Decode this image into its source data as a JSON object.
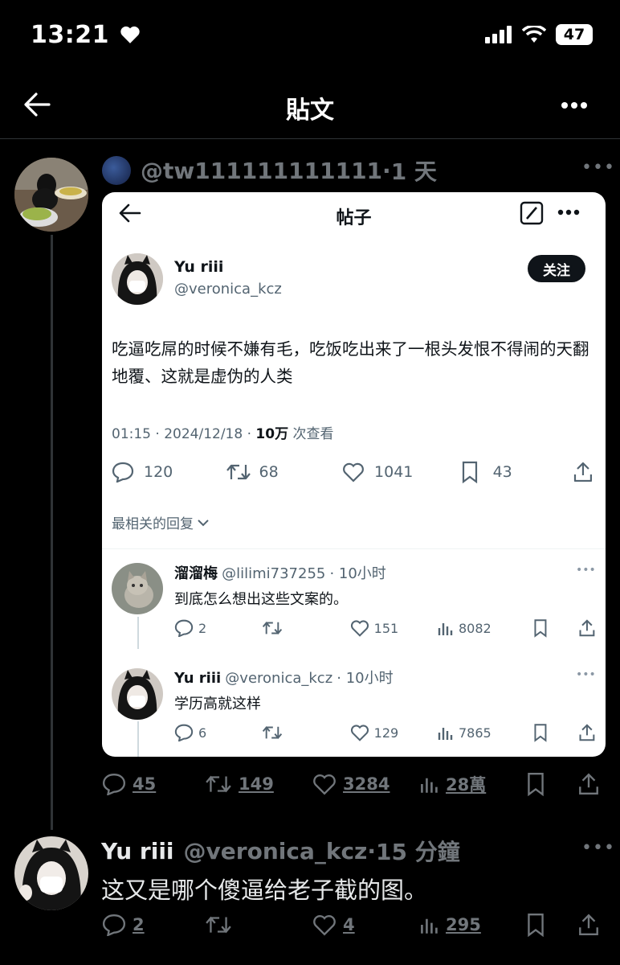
{
  "status": {
    "time": "13:21",
    "battery": "47"
  },
  "header": {
    "title": "貼文"
  },
  "quote_post": {
    "handle": "@tw111111111111",
    "separator": "·",
    "time": "1 天",
    "stats": {
      "replies": "45",
      "retweets": "149",
      "likes": "3284",
      "views": "28萬"
    }
  },
  "embedded": {
    "title": "帖子",
    "author_name": "Yu riii",
    "author_handle": "@veronica_kcz",
    "follow_label": "关注",
    "text": "吃逼吃屌的时候不嫌有毛，吃饭吃出来了一根头发恨不得闹的天翻地覆、这就是虚伪的人类",
    "meta_time": "01:15 · 2024/12/18 · ",
    "meta_views": "10万",
    "meta_views_suffix": " 次查看",
    "stats": {
      "replies": "120",
      "retweets": "68",
      "likes": "1041",
      "bookmarks": "43"
    },
    "filter_label": "最相关的回复",
    "replies": [
      {
        "name": "溜溜梅",
        "handle": "@lilimi737255",
        "time": "· 10小时",
        "text": "到底怎么想出这些文案的。",
        "stats": {
          "replies": "2",
          "likes": "151",
          "views": "8082"
        }
      },
      {
        "name": "Yu riii",
        "handle": "@veronica_kcz",
        "time": "· 10小时",
        "text": "学历高就这样",
        "stats": {
          "replies": "6",
          "likes": "129",
          "views": "7865"
        }
      }
    ]
  },
  "reply_post": {
    "name": "Yu riii",
    "handle": "@veronica_kcz",
    "separator": "·",
    "time": "15 分鐘",
    "text": "这又是哪个傻逼给老子截的图。",
    "stats": {
      "replies": "2",
      "likes": "4",
      "views": "295"
    }
  },
  "icons": [
    "back-arrow-icon",
    "more-icon",
    "reply-icon",
    "retweet-icon",
    "like-icon",
    "views-icon",
    "bookmark-icon",
    "share-icon",
    "edit-icon",
    "chevron-down-icon",
    "signal-icon",
    "wifi-icon",
    "heart-icon"
  ]
}
